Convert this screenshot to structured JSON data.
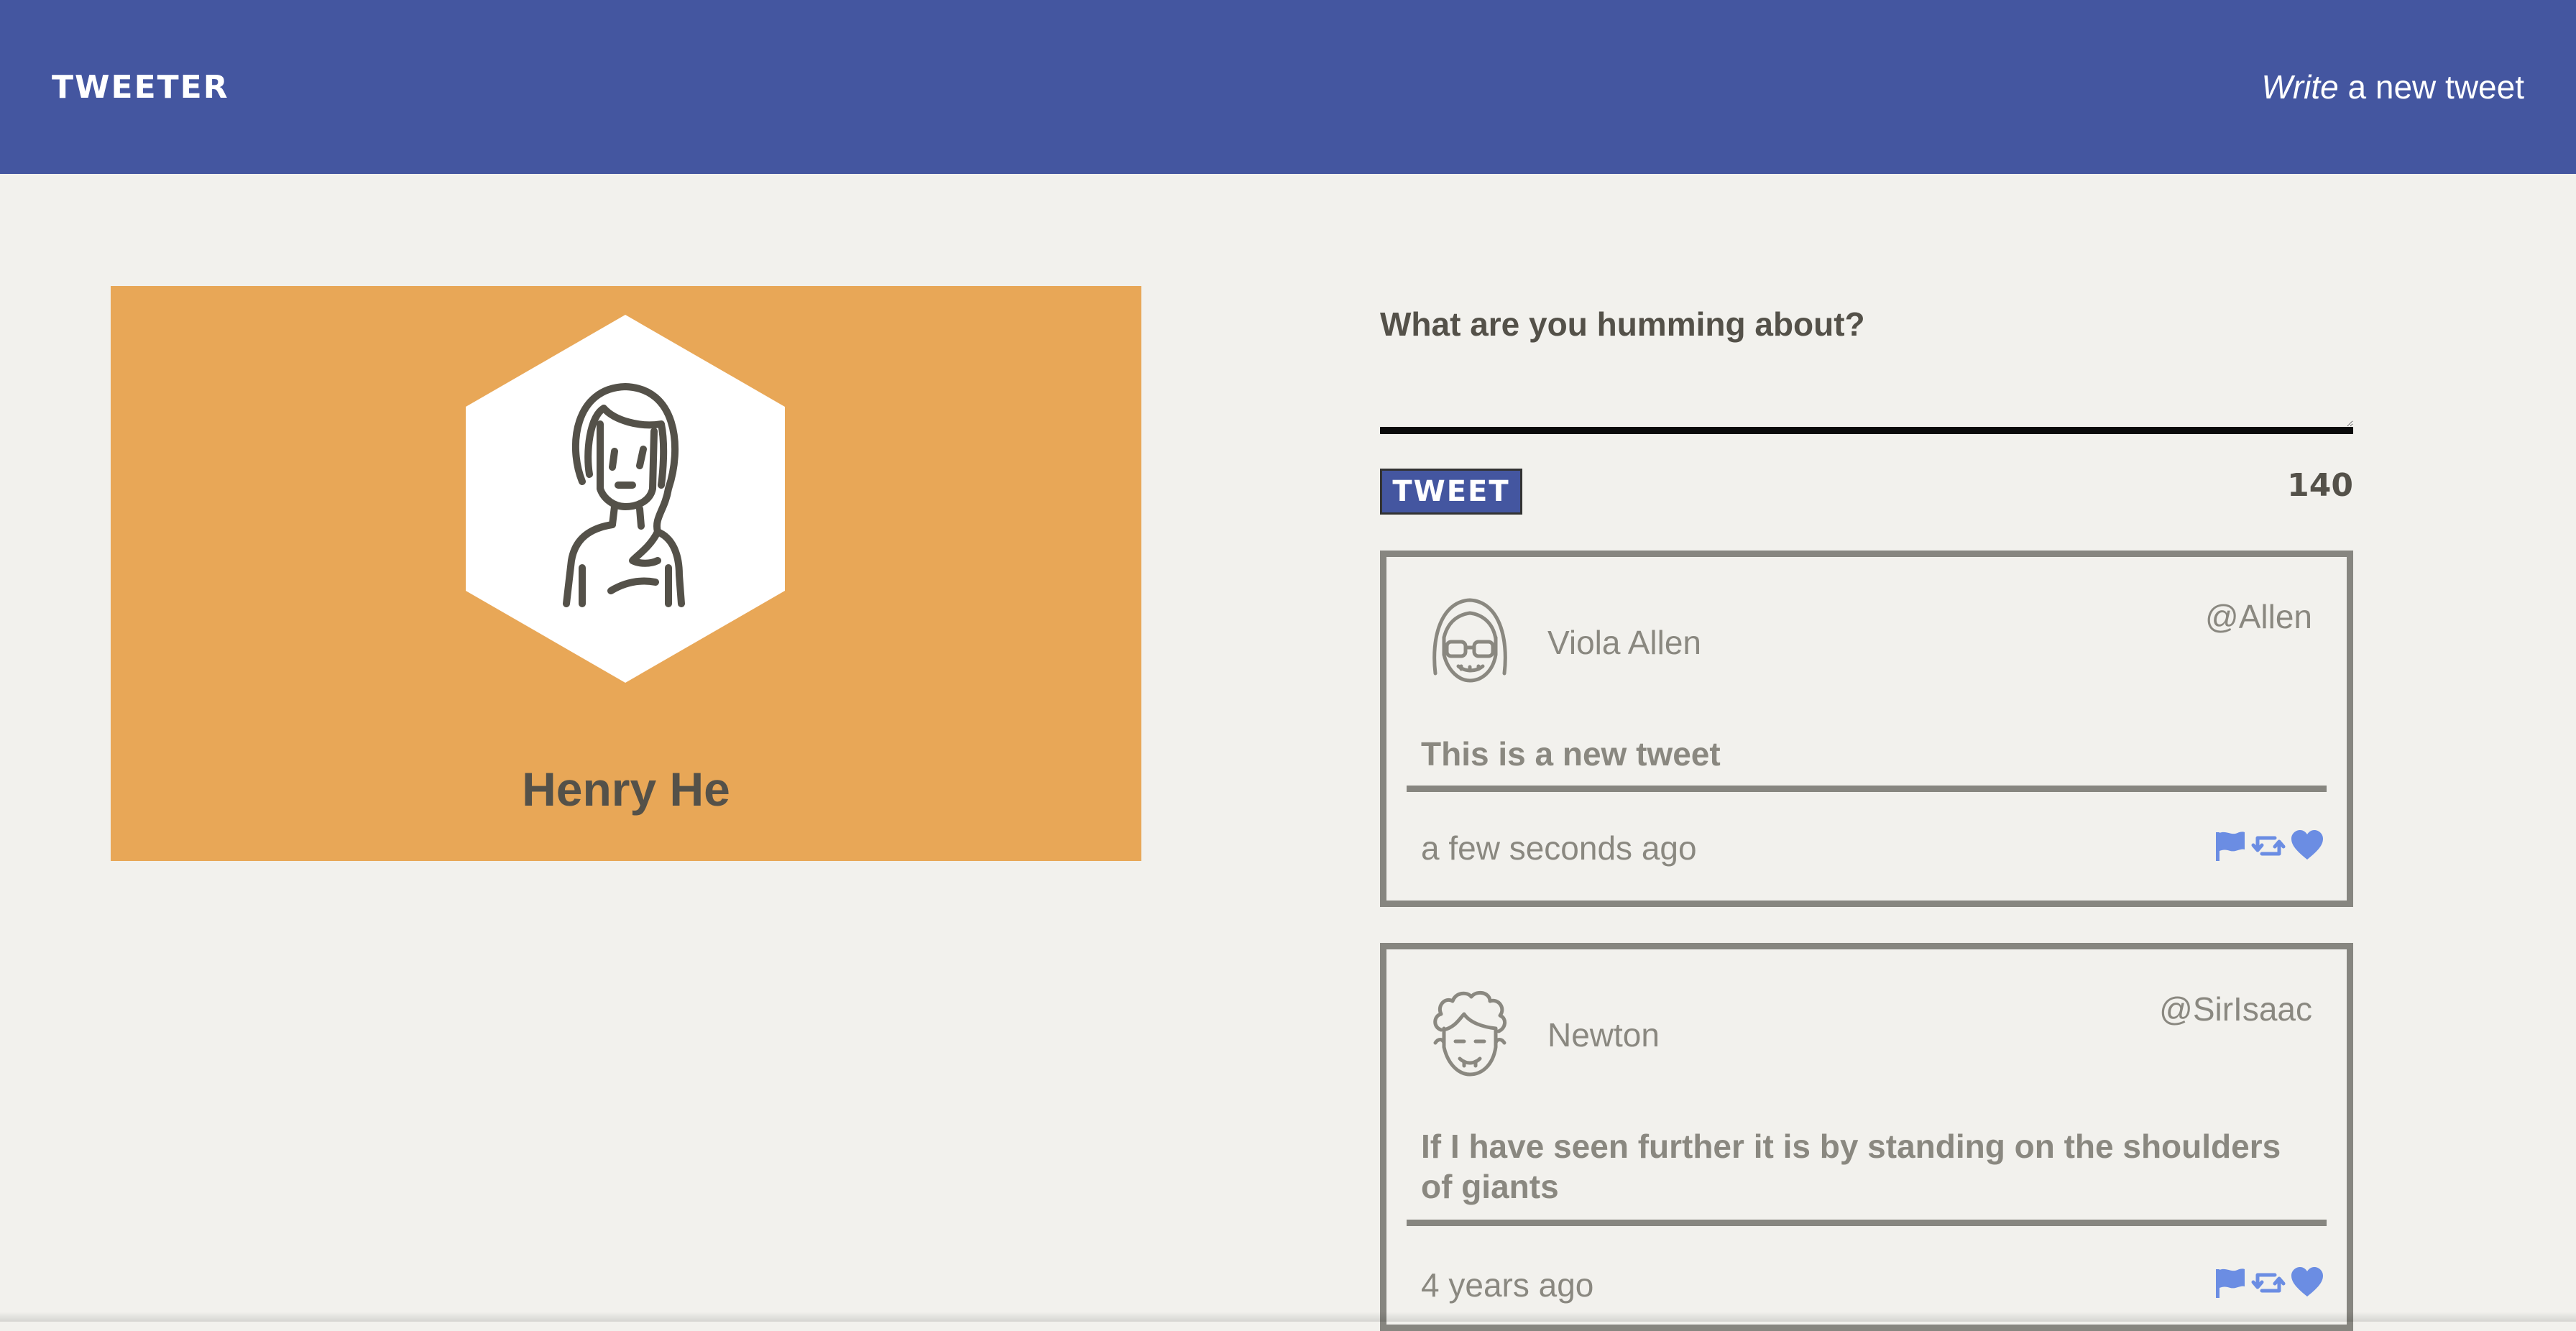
{
  "nav": {
    "brand": "TWEETER",
    "compose_emphasis": "Write",
    "compose_rest": " a new tweet"
  },
  "profile": {
    "name": "Henry He",
    "avatar_icon": "woman-avatar-icon",
    "card_color": "#e8a757"
  },
  "composer": {
    "label": "What are you humming about?",
    "value": "",
    "placeholder": "",
    "button_label": "TWEET",
    "counter": "140"
  },
  "tweets": [
    {
      "name": "Viola Allen",
      "handle": "@Allen",
      "text": "This is a new tweet",
      "time": "a few seconds ago",
      "avatar_icon": "girl-with-glasses-avatar-icon"
    },
    {
      "name": "Newton",
      "handle": "@SirIsaac",
      "text": "If I have seen further it is by standing on the shoulders of giants",
      "time": "4 years ago",
      "avatar_icon": "curly-hair-man-avatar-icon"
    }
  ],
  "actions": [
    "flag-icon",
    "retweet-icon",
    "heart-icon"
  ],
  "colors": {
    "nav": "#4456a0",
    "background": "#f2f1ed",
    "accent_icons": "#6b8de3",
    "text": "#545149",
    "muted": "#8a8880"
  }
}
